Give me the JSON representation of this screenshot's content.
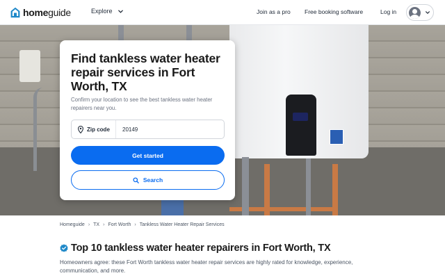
{
  "header": {
    "logo_bold": "home",
    "logo_light": "guide",
    "explore_label": "Explore",
    "nav": {
      "join_pro": "Join as a pro",
      "booking": "Free booking software",
      "login": "Log in"
    }
  },
  "search_card": {
    "title": "Find tankless water heater repair services in Fort Worth, TX",
    "description": "Confirm your location to see the best tankless water heater repairers near you.",
    "zip_label": "Zip code",
    "zip_value": "20149",
    "primary_button": "Get started",
    "secondary_button": "Search"
  },
  "breadcrumb": [
    "Homeguide",
    "TX",
    "Fort Worth",
    "Tankless Water Heater Repair Services"
  ],
  "main": {
    "heading": "Top 10 tankless water heater repairers in Fort Worth, TX",
    "intro": "Homeowners agree: these Fort Worth tankless water heater repair services are highly rated for knowledge, experience, communication, and more."
  },
  "colors": {
    "brand_blue": "#0a6cf0",
    "logo_teal": "#1e88c8"
  },
  "icons": {
    "logo": "house-icon",
    "explore": "chevron-down-icon",
    "account": "avatar-icon",
    "zip": "map-pin-icon",
    "search": "search-icon",
    "verified": "verified-badge-icon"
  }
}
